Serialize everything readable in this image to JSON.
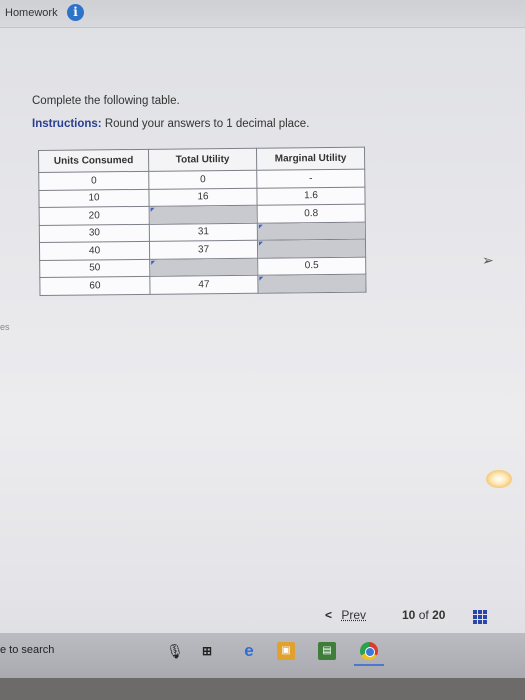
{
  "header": {
    "title": "Homework",
    "info_icon": "info-icon"
  },
  "question": {
    "prompt": "Complete the following table.",
    "instructions_label": "Instructions:",
    "instructions_text": "Round your answers to 1 decimal place."
  },
  "table": {
    "headers": [
      "Units Consumed",
      "Total Utility",
      "Marginal Utility"
    ],
    "rows": [
      {
        "units": "0",
        "total": "0",
        "marginal": "-"
      },
      {
        "units": "10",
        "total": "16",
        "marginal": "1.6"
      },
      {
        "units": "20",
        "total": "",
        "marginal": "0.8"
      },
      {
        "units": "30",
        "total": "31",
        "marginal": ""
      },
      {
        "units": "40",
        "total": "37",
        "marginal": ""
      },
      {
        "units": "50",
        "total": "",
        "marginal": "0.5"
      },
      {
        "units": "60",
        "total": "47",
        "marginal": ""
      }
    ]
  },
  "side_text": "es",
  "pagination": {
    "prev_label": "Prev",
    "current": "10",
    "of_label": "of",
    "total": "20"
  },
  "taskbar": {
    "search_text": "e to search"
  },
  "colors": {
    "accent": "#2a3f8f",
    "info": "#2f73c8",
    "input_fill": "#c9cad0",
    "grid_icon": "#2a46a8"
  }
}
